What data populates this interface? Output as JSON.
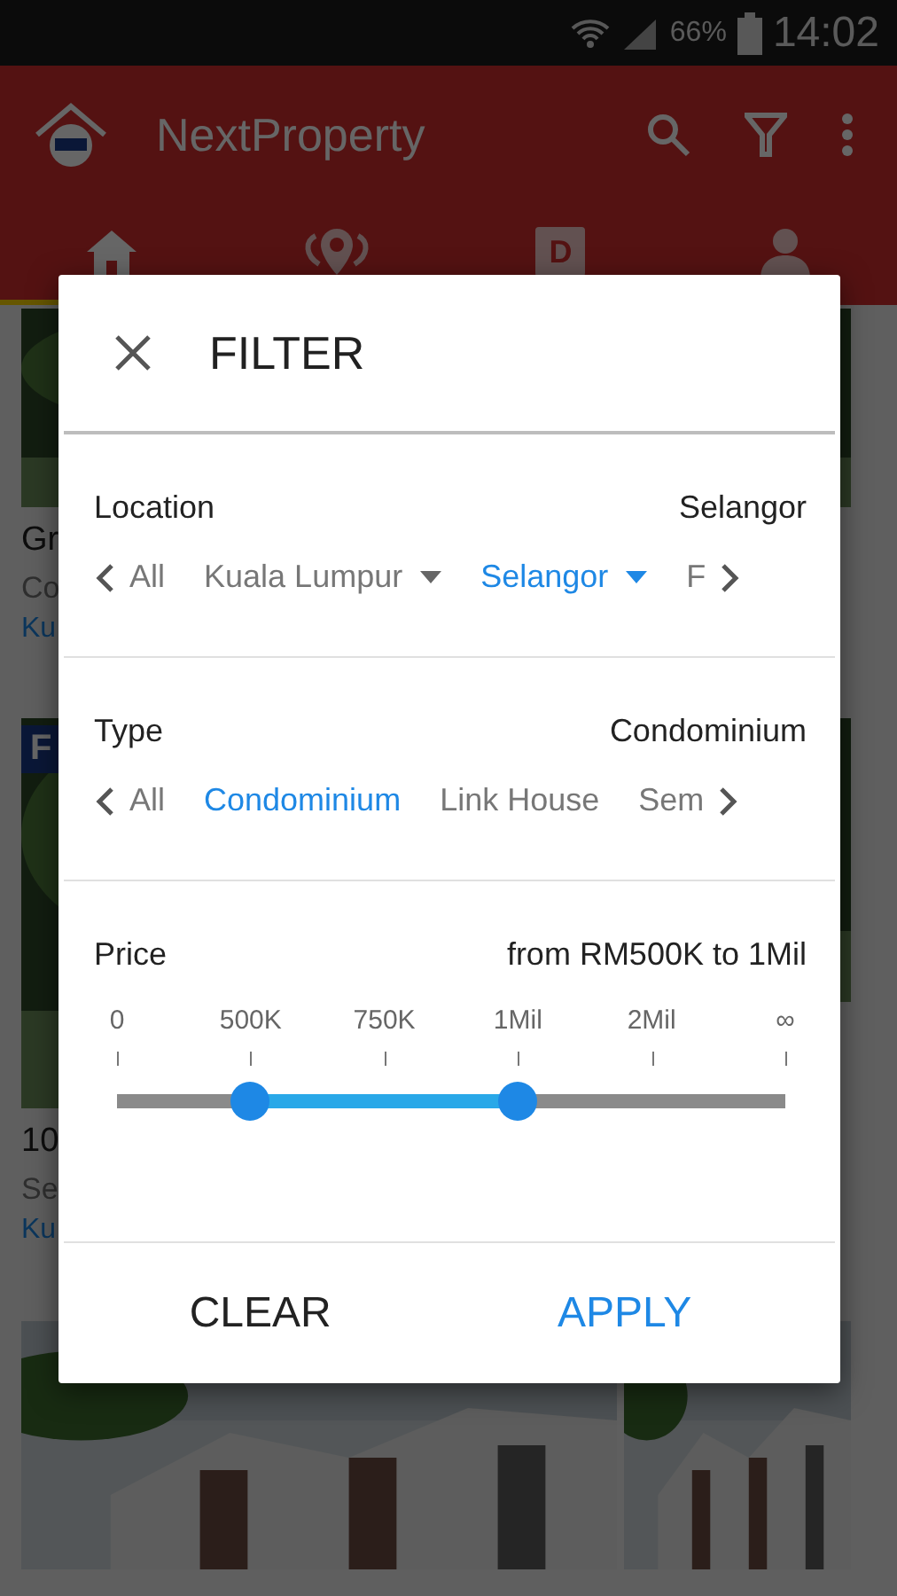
{
  "status_bar": {
    "battery": "66%",
    "time": "14:02"
  },
  "app_bar": {
    "title": "NextProperty"
  },
  "tabs": [
    {
      "kind": "home",
      "selected": true
    },
    {
      "kind": "pins",
      "selected": false
    },
    {
      "kind": "letter",
      "label": "D",
      "selected": false
    },
    {
      "kind": "person",
      "selected": false
    }
  ],
  "listing": [
    {
      "title": "Gr",
      "subtitle": "Co",
      "location": "Ku"
    },
    {
      "badge": "F",
      "title": "10",
      "subtitle": "Se",
      "location": "Ku"
    }
  ],
  "dialog": {
    "title": "FILTER",
    "sections": [
      {
        "kind": "chips",
        "label": "Location",
        "value": "Selangor",
        "options": [
          {
            "label": "All",
            "selected": false
          },
          {
            "label": "Kuala Lumpur",
            "selected": false,
            "dropdown": true
          },
          {
            "label": "Selangor",
            "selected": true,
            "dropdown": true
          },
          {
            "label": "F",
            "selected": false
          }
        ]
      },
      {
        "kind": "chips",
        "label": "Type",
        "value": "Condominium",
        "options": [
          {
            "label": "All",
            "selected": false
          },
          {
            "label": "Condominium",
            "selected": true
          },
          {
            "label": "Link House",
            "selected": false
          },
          {
            "label": "Sem",
            "selected": false
          }
        ]
      },
      {
        "kind": "range",
        "label": "Price",
        "value": "from RM500K to 1Mil",
        "ticks": [
          "0",
          "500K",
          "750K",
          "1Mil",
          "2Mil",
          "∞"
        ],
        "low": {
          "level": 0.2
        },
        "high": {
          "level": 0.6
        }
      }
    ],
    "buttons": [
      {
        "label": "CLEAR",
        "kind": "plain"
      },
      {
        "label": "APPLY",
        "kind": "primary"
      }
    ]
  }
}
